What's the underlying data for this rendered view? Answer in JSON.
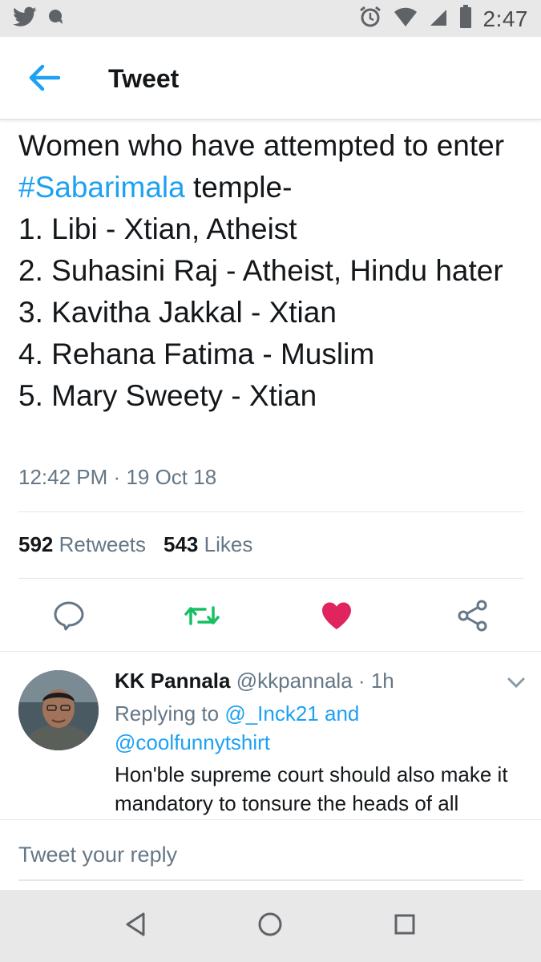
{
  "status_bar": {
    "time": "2:47",
    "icons": [
      "twitter-bird-icon",
      "chat-bubble-icon",
      "alarm-icon",
      "wifi-icon",
      "cell-signal-icon",
      "battery-icon"
    ]
  },
  "header": {
    "title": "Tweet",
    "back_icon": "back-arrow-icon"
  },
  "tweet": {
    "text_before_hashtag": "Women who have attempted to enter ",
    "hashtag": "#Sabarimala",
    "text_after_hashtag": " temple-\n1. Libi - Xtian, Atheist\n2. Suhasini Raj - Atheist, Hindu hater\n3. Kavitha Jakkal - Xtian\n4. Rehana Fatima - Muslim\n5. Mary Sweety - Xtian",
    "time": "12:42 PM",
    "separator": "·",
    "date": "19 Oct 18",
    "retweets_count": "592",
    "retweets_label": "Retweets",
    "likes_count": "543",
    "likes_label": "Likes"
  },
  "actions": {
    "reply_icon": "reply-icon",
    "retweet_icon": "retweet-icon",
    "like_icon": "heart-icon",
    "share_icon": "share-icon"
  },
  "colors": {
    "accent": "#1da1f2",
    "retweet": "#17bf63",
    "like": "#e0245e",
    "muted": "#657786"
  },
  "reply": {
    "name": "KK Pannala",
    "handle": "@kkpannala",
    "separator": "·",
    "age": "1h",
    "replying_prefix": "Replying to ",
    "replying_user1": "@_Inck21",
    "replying_and": " and",
    "replying_user2": "@coolfunnytshirt",
    "text": "Hon'ble supreme court should also make it mandatory to tonsure the heads of all"
  },
  "compose": {
    "placeholder": "Tweet your reply"
  },
  "nav_bar": {
    "back_icon": "nav-back-icon",
    "home_icon": "nav-home-icon",
    "recents_icon": "nav-recents-icon"
  }
}
